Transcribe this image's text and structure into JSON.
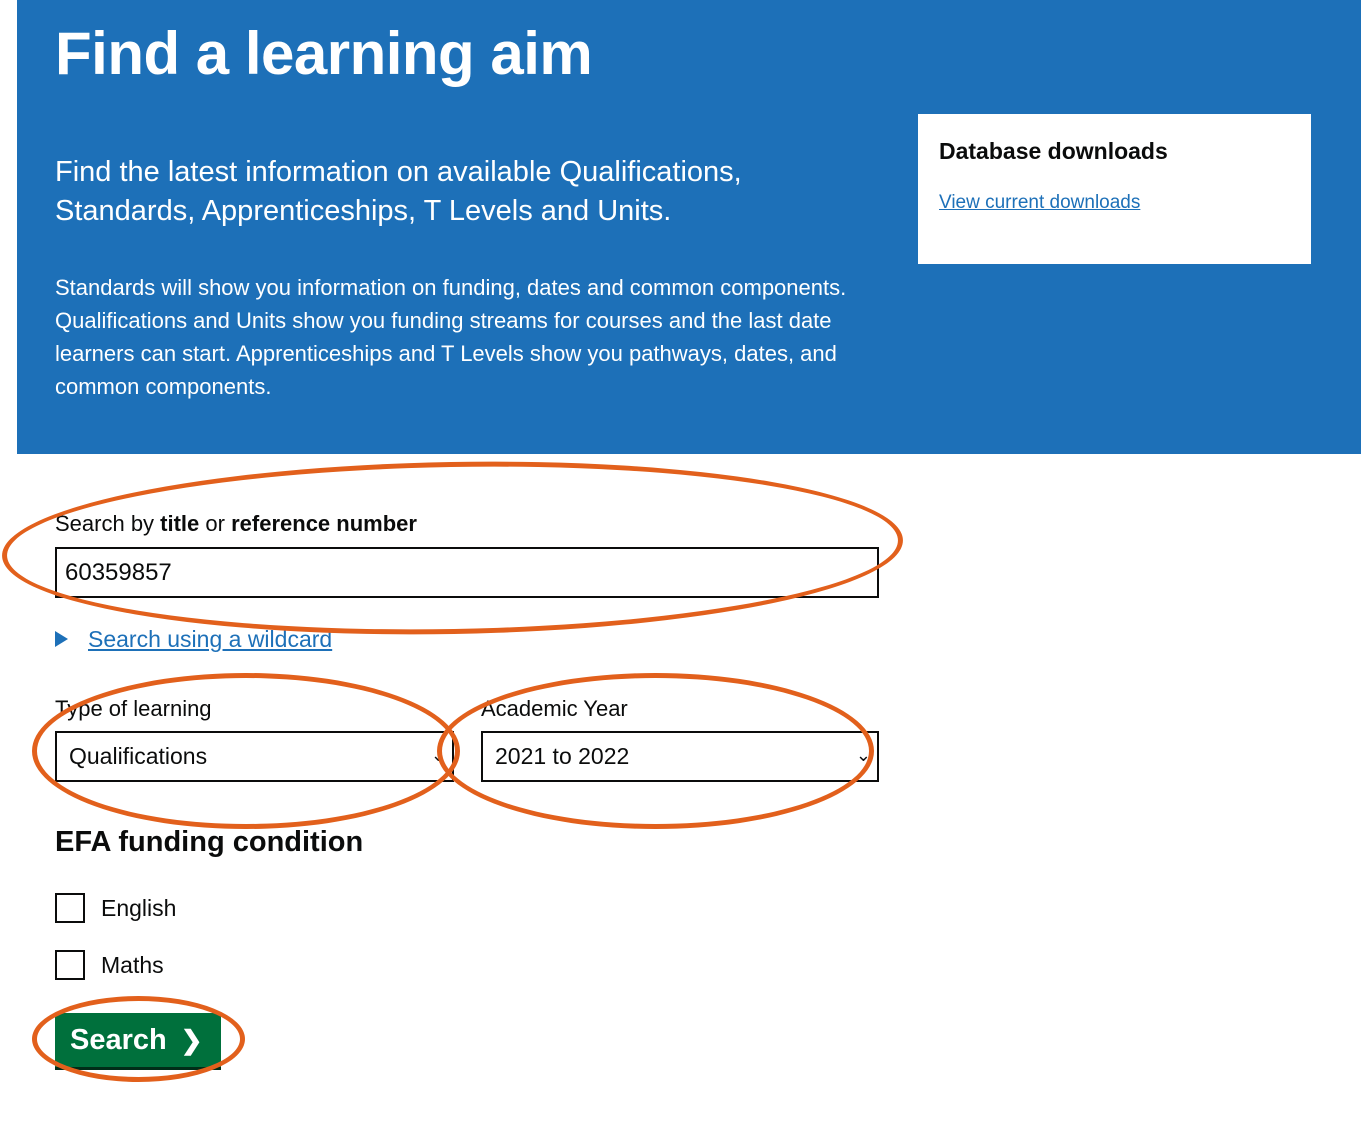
{
  "hero": {
    "title": "Find a learning aim",
    "lead": "Find the latest information on available Qualifications, Standards, Apprenticeships, T Levels and Units.",
    "body": "Standards will show you information on funding, dates and common components. Qualifications and Units show you funding streams for courses and the last date learners can start. Apprenticeships and T Levels show you pathways, dates, and common components."
  },
  "downloads": {
    "title": "Database downloads",
    "link": "View current downloads"
  },
  "search": {
    "label_prefix": "Search by ",
    "label_title": "title",
    "label_or": " or ",
    "label_reference": "reference number",
    "value": "60359857",
    "wildcard_link": "Search using a wildcard"
  },
  "filters": {
    "type_label": "Type of learning",
    "type_value": "Qualifications",
    "year_label": "Academic Year",
    "year_value": "2021 to 2022"
  },
  "efa": {
    "title": "EFA funding condition",
    "options": [
      "English",
      "Maths"
    ]
  },
  "button": {
    "label": "Search",
    "chevron": "❯"
  },
  "colors": {
    "hero_bg": "#1d70b8",
    "button_bg": "#00703c",
    "link": "#1d70b8",
    "annotation_ring": "#e2601c"
  }
}
